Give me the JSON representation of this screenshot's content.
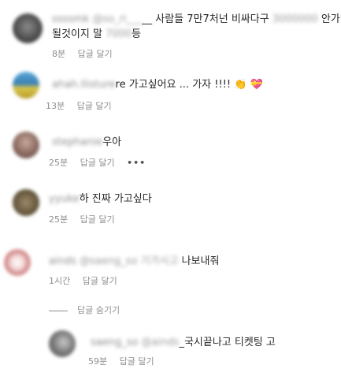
{
  "comments": [
    {
      "username": "ssssmk",
      "mention": "@so_ri___",
      "text_line1": "__ 사람들 7만7처넌 비싸다구 ",
      "text_blur1": "3000000",
      "text_line1b": " 안가면",
      "text_line2": "될것이지 말 ",
      "text_blur2": "7000",
      "text_line2b": "등",
      "time": "8분",
      "reply_label": "답글 달기"
    },
    {
      "username": "ahah.llisture",
      "text": "re 가고싶어요 ... 가자 !!!! ",
      "emoji1": "👏",
      "emoji2": "💝",
      "time": "13분",
      "reply_label": "답글 달기"
    },
    {
      "username": "stephanie",
      "text": "우아",
      "time": "25분",
      "reply_label": "답글 달기",
      "more": "•••"
    },
    {
      "username": "yyuke",
      "text": "하 진짜 가고싶다",
      "time": "25분",
      "reply_label": "답글 달기"
    },
    {
      "username": "ainds",
      "mention": "@saeng_so 기가시고",
      "text": "나보내줘",
      "time": "1시간",
      "reply_label": "답글 달기"
    }
  ],
  "hide_replies_label": "답글 숨기기",
  "reply": {
    "username": "saeng_so",
    "mention": "@ainds",
    "text": "_국시끝나고 티켓팅 고",
    "time": "59분",
    "reply_label": "답글 달기"
  }
}
